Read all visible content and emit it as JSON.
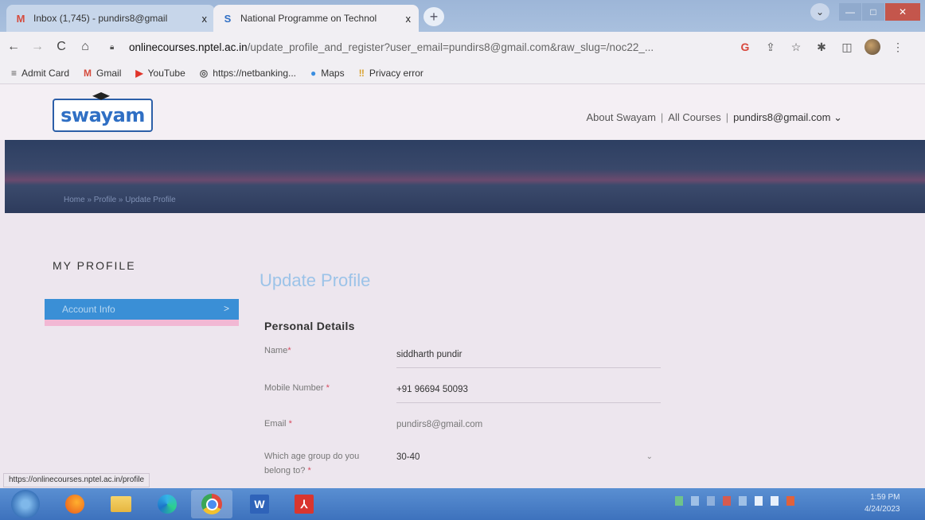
{
  "tabs": [
    {
      "title": "Inbox (1,745) - pundirs8@gmail",
      "favicon": "gmail-icon",
      "close": "x"
    },
    {
      "title": "National Programme on Technol",
      "favicon": "swayam-icon",
      "close": "x"
    }
  ],
  "window_controls": {
    "new_tab": "+",
    "dropdown": "⌄",
    "minimize": "—",
    "maximize": "□",
    "close": "✕"
  },
  "toolbar": {
    "back": "←",
    "forward": "→",
    "reload": "C",
    "home": "⌂",
    "url_host": "onlinecourses.nptel.ac.in",
    "url_path": "/update_profile_and_register?user_email=pundirs8@gmail.com&raw_slug=/noc22_...",
    "google_icon": "G",
    "share_icon": "⇪",
    "star_icon": "☆",
    "extensions_icon": "✱",
    "sidepanel_icon": "◫",
    "menu_icon": "⋮"
  },
  "bookmarks": [
    {
      "label": "Admit Card",
      "icon": "admit-card-icon",
      "glyph": "≡",
      "color": "#555555"
    },
    {
      "label": "Gmail",
      "icon": "gmail-icon",
      "glyph": "M",
      "color": "#d54b3d"
    },
    {
      "label": "YouTube",
      "icon": "youtube-icon",
      "glyph": "▶",
      "color": "#e0342a"
    },
    {
      "label": "https://netbanking...",
      "icon": "globe-icon",
      "glyph": "◎",
      "color": "#555555"
    },
    {
      "label": "Maps",
      "icon": "maps-pin-icon",
      "glyph": "●",
      "color": "#3b8ee0"
    },
    {
      "label": "Privacy error",
      "icon": "privacy-error-icon",
      "glyph": "‼",
      "color": "#d9a12c"
    }
  ],
  "site": {
    "logo_text": "swayam",
    "nav": {
      "about": "About Swayam",
      "separator": "|",
      "all_courses": "All Courses",
      "user": "pundirs8@gmail.com",
      "user_caret": "⌄"
    },
    "breadcrumb": "Home  »  Profile  »  Update Profile"
  },
  "sidebar": {
    "title": "MY PROFILE",
    "account_info": "Account Info",
    "chevron": ">"
  },
  "form": {
    "title": "Update Profile",
    "section": "Personal Details",
    "required_mark": "*",
    "fields": {
      "name": {
        "label": "Name",
        "value": "siddharth pundir"
      },
      "mobile": {
        "label": "Mobile Number",
        "value": "+91 96694 50093"
      },
      "email": {
        "label": "Email",
        "value": "pundirs8@gmail.com"
      },
      "age_group": {
        "label": "Which age group do you belong to?",
        "value": "30-40",
        "caret": "⌄"
      }
    }
  },
  "status_url": "https://onlinecourses.nptel.ac.in/profile",
  "taskbar": {
    "word_letter": "W",
    "pdf_letter": "⅄",
    "clock_time": "1:59 PM",
    "clock_date": "4/24/2023"
  },
  "colors": {
    "banner": "#2d3f62",
    "accent_blue": "#3a8fd6",
    "title_blue": "#9cc3e8",
    "required": "#d84a5e"
  }
}
